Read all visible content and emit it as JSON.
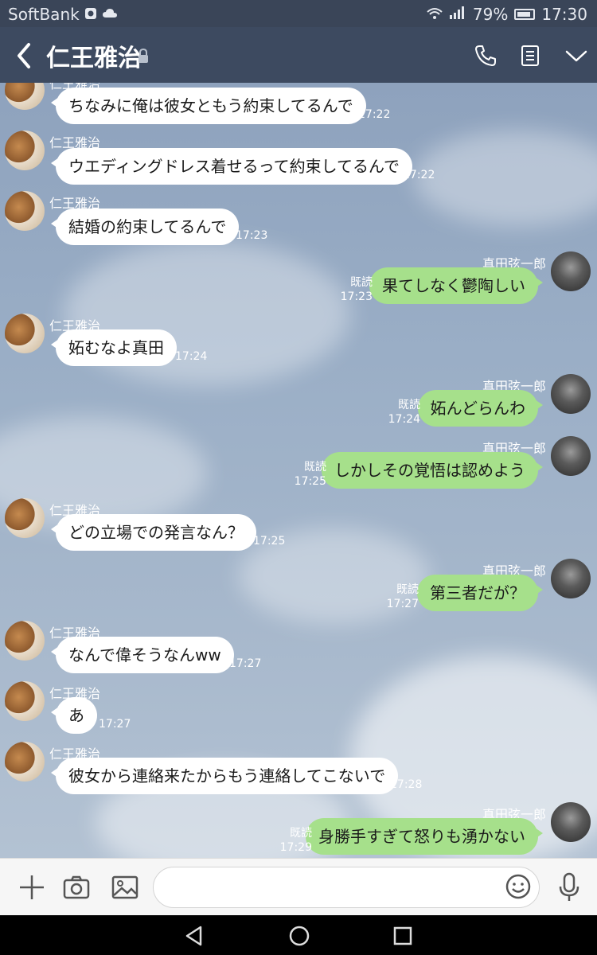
{
  "status_bar": {
    "carrier": "SoftBank",
    "battery": "79%",
    "time": "17:30"
  },
  "header": {
    "title": "仁王雅治"
  },
  "input": {
    "placeholder": ""
  },
  "messages": [
    {
      "side": "left",
      "sender": "仁王雅治",
      "text": "ちなみに俺は彼女ともう約束してるんで",
      "time": "17:22"
    },
    {
      "side": "left",
      "sender": "仁王雅治",
      "text": "ウエディングドレス着せるって約束してるんで",
      "time": "17:22"
    },
    {
      "side": "left",
      "sender": "仁王雅治",
      "text": "結婚の約束してるんで",
      "time": "17:23"
    },
    {
      "side": "right",
      "sender": "真田弦一郎",
      "text": "果てしなく鬱陶しい",
      "read": "既読",
      "time": "17:23"
    },
    {
      "side": "left",
      "sender": "仁王雅治",
      "text": "妬むなよ真田",
      "time": "17:24"
    },
    {
      "side": "right",
      "sender": "真田弦一郎",
      "text": "妬んどらんわ",
      "read": "既読",
      "time": "17:24"
    },
    {
      "side": "right",
      "sender": "真田弦一郎",
      "text": "しかしその覚悟は認めよう",
      "read": "既読",
      "time": "17:25"
    },
    {
      "side": "left",
      "sender": "仁王雅治",
      "text": "どの立場での発言なん？",
      "time": "17:25"
    },
    {
      "side": "right",
      "sender": "真田弦一郎",
      "text": "第三者だが？",
      "read": "既読",
      "time": "17:27"
    },
    {
      "side": "left",
      "sender": "仁王雅治",
      "text": "なんで偉そうなんww",
      "time": "17:27"
    },
    {
      "side": "left",
      "sender": "仁王雅治",
      "text": "あ",
      "time": "17:27"
    },
    {
      "side": "left",
      "sender": "仁王雅治",
      "text": "彼女から連絡来たからもう連絡してこないで",
      "time": "17:28"
    },
    {
      "side": "right",
      "sender": "真田弦一郎",
      "text": "身勝手すぎて怒りも湧かない",
      "read": "既読",
      "time": "17:29"
    }
  ]
}
